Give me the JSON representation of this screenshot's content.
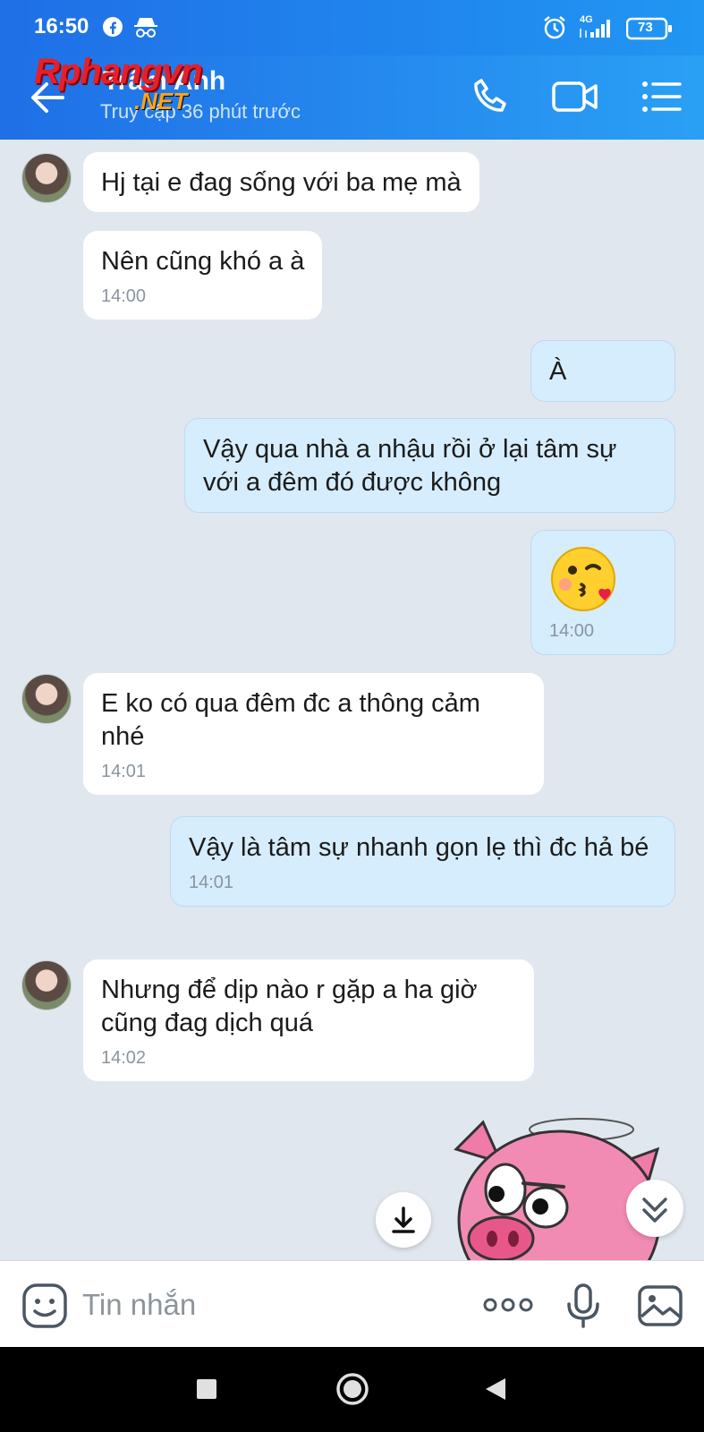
{
  "status_bar": {
    "time": "16:50",
    "network": "4G",
    "battery": "73",
    "icons": [
      "facebook-icon",
      "incognito-icon",
      "alarm-icon",
      "signal-icon",
      "battery-icon"
    ]
  },
  "header": {
    "title": "Trâm Anh",
    "subtitle": "Truy cập 36 phút trước",
    "watermark_main": "Rphangvn",
    "watermark_sub": ".NET",
    "icons": [
      "back-arrow-icon",
      "phone-icon",
      "video-call-icon",
      "menu-icon"
    ]
  },
  "messages": [
    {
      "dir": "in",
      "text": "Hj tại e đag sống với ba mẹ mà",
      "time": ""
    },
    {
      "dir": "in",
      "text": "Nên cũng khó a à",
      "time": "14:00"
    },
    {
      "dir": "out",
      "text": "À",
      "time": ""
    },
    {
      "dir": "out",
      "text": "Vậy qua nhà a nhậu rồi ở lại tâm sự với a đêm đó được không",
      "time": ""
    },
    {
      "dir": "out",
      "emoji": "kissing-face-emoji",
      "time": "14:00"
    },
    {
      "dir": "in",
      "text": "E ko có qua đêm đc a thông cảm nhé",
      "time": "14:01"
    },
    {
      "dir": "out",
      "text": "Vậy là tâm sự nhanh gọn lẹ thì đc hả bé",
      "time": "14:01"
    },
    {
      "dir": "in",
      "text": "Nhưng để dịp nào r gặp a ha giờ cũng đag dịch quá",
      "time": "14:02"
    }
  ],
  "input": {
    "placeholder": "Tin nhắn",
    "icons": [
      "sticker-icon",
      "more-icon",
      "microphone-icon",
      "image-icon"
    ]
  },
  "floating": {
    "icons": [
      "download-icon",
      "scroll-down-icon",
      "pig-sticker"
    ]
  },
  "nav_bar": {
    "icons": [
      "recent-apps-icon",
      "home-icon",
      "back-icon"
    ]
  },
  "colors": {
    "header": "#2196f3",
    "incoming_bubble": "#ffffff",
    "outgoing_bubble": "#d6edfd",
    "chat_background": "#e1e7ef"
  }
}
